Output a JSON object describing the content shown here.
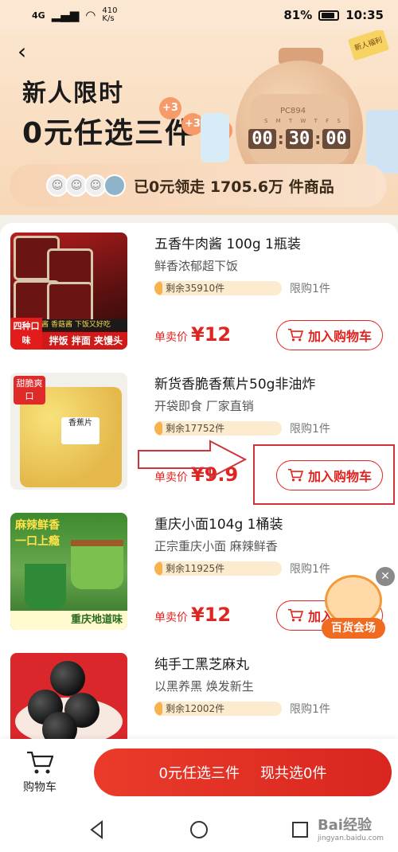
{
  "status_bar": {
    "network_signal": "4G",
    "network_speed_value": "410",
    "network_speed_unit": "K/s",
    "battery": "81%",
    "time": "10:35"
  },
  "hero": {
    "title_line1": "新人限时",
    "title_line2": "0元任选三件",
    "plus_badges": [
      "+3",
      "+3",
      "+3"
    ],
    "clock_code": "PC894",
    "clock_days": "S M T W T F S",
    "timer": {
      "hh": "00",
      "mm": "30",
      "ss": "00"
    },
    "ticket_text": "新人福利",
    "stats_text": "已0元领走 1705.6万 件商品"
  },
  "products": [
    {
      "title": "五香牛肉酱 100g 1瓶装",
      "subtitle": "鲜香浓郁超下饭",
      "stock": "剩余35910件",
      "limit": "限购1件",
      "price_label": "单卖价",
      "price": "¥12",
      "button": "加入购物车",
      "thumb_band": "牛肉酱 香菇酱 下饭又好吃",
      "thumb_banner": "拌饭 拌面 夹馒头",
      "thumb_corner": "四种口味"
    },
    {
      "title": "新货香脆香蕉片50g非油炸",
      "subtitle": "开袋即食 厂家直销",
      "stock": "剩余17752件",
      "limit": "限购1件",
      "price_label": "单卖价",
      "price": "¥9.9",
      "button": "加入购物车",
      "thumb_tag": "甜脆爽口",
      "thumb_label": "香蕉片"
    },
    {
      "title": "重庆小面104g 1桶装",
      "subtitle": "正宗重庆小面 麻辣鲜香",
      "stock": "剩余11925件",
      "limit": "限购1件",
      "price_label": "单卖价",
      "price": "¥12",
      "button": "加入购物车",
      "thumb_head": "麻辣鲜香 一口上瘾",
      "thumb_foot": "重庆地道味"
    },
    {
      "title": "纯手工黑芝麻丸",
      "subtitle": "以黑养黑 焕发新生",
      "stock": "剩余12002件",
      "limit": "限购1件"
    }
  ],
  "float_ad": {
    "label": "百货会场"
  },
  "bottom_bar": {
    "cart_label": "购物车",
    "main_button_left": "0元任选三件",
    "main_button_right": "现共选0件"
  },
  "watermark": {
    "main": "Bai经验",
    "sub": "jingyan.baidu.com"
  },
  "colors": {
    "accent": "#e0241f",
    "hero_bg": "#fbe5cd"
  }
}
